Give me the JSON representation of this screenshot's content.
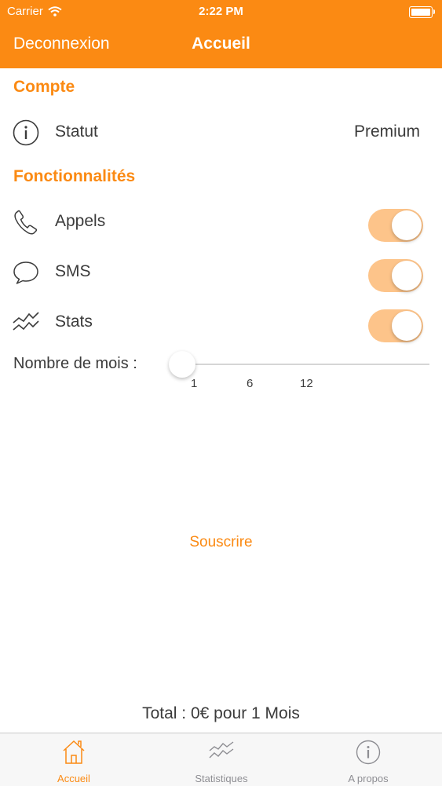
{
  "status_bar": {
    "carrier": "Carrier",
    "time": "2:22 PM"
  },
  "nav": {
    "left_button": "Deconnexion",
    "title": "Accueil"
  },
  "sections": {
    "account": {
      "title": "Compte",
      "statut_label": "Statut",
      "statut_value": "Premium"
    },
    "features": {
      "title": "Fonctionnalités",
      "items": [
        {
          "label": "Appels",
          "icon": "phone-icon",
          "enabled": true
        },
        {
          "label": "SMS",
          "icon": "speech-bubble-icon",
          "enabled": true
        },
        {
          "label": "Stats",
          "icon": "stats-icon",
          "enabled": true
        }
      ]
    }
  },
  "months": {
    "label": "Nombre de mois :",
    "ticks": [
      "1",
      "6",
      "12"
    ],
    "selected": 1
  },
  "subscribe_label": "Souscrire",
  "total_text": "Total : 0€ pour 1 Mois",
  "tabs": [
    {
      "label": "Accueil",
      "icon": "home-icon",
      "active": true
    },
    {
      "label": "Statistiques",
      "icon": "stats-icon",
      "active": false
    },
    {
      "label": "A propos",
      "icon": "info-icon",
      "active": false
    }
  ],
  "colors": {
    "accent": "#fb8a13",
    "switch_on": "#fdc48a",
    "text": "#3b3b3b"
  }
}
